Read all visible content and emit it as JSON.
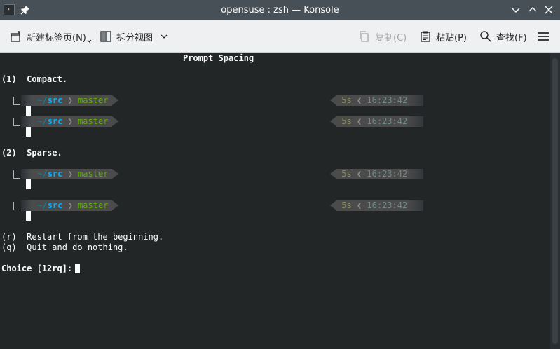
{
  "window": {
    "title": "opensuse : zsh — Konsole"
  },
  "toolbar": {
    "new_tab": "新建标签页(N)",
    "split_view": "拆分视图",
    "copy": "复制(C)",
    "paste": "粘贴(P)",
    "find": "查找(F)"
  },
  "terminal": {
    "heading": "Prompt Spacing",
    "option1": "(1)  Compact.",
    "option2": "(2)  Sparse.",
    "restart": "(r)  Restart from the beginning.",
    "quit": "(q)  Quit and do nothing.",
    "choice": "Choice [12rq]: "
  },
  "prompt": {
    "tilde": "~/",
    "dir": "src",
    "sep": "❯",
    "branch": "master",
    "duration": "5s",
    "rsep": "❮",
    "time": "16:23:42"
  },
  "colors": {
    "terminal_bg": "#232627",
    "titlebar_bg": "#475057",
    "toolbar_bg": "#eff0f1",
    "dir_color": "#00afff",
    "branch_color": "#5faf00",
    "segment_bg": "#4b4b4b"
  },
  "icons": {
    "app": "terminal-icon",
    "pin": "pin-icon",
    "minimize": "chevron-down-icon",
    "maximize": "chevron-up-icon",
    "close": "close-icon",
    "new_tab": "new-tab-icon",
    "split": "split-view-icon",
    "copy": "copy-icon",
    "paste": "paste-icon",
    "find": "search-icon",
    "menu": "hamburger-menu-icon"
  }
}
